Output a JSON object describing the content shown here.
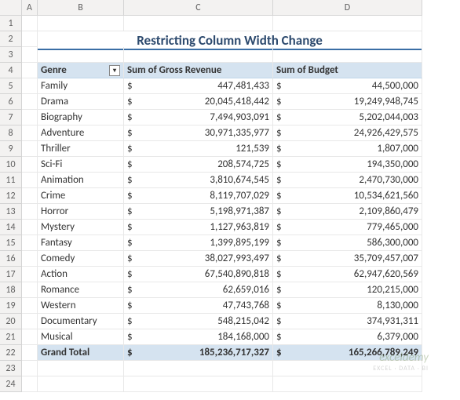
{
  "title": "Restricting Column Width Change",
  "columns": [
    "",
    "A",
    "B",
    "C",
    "D"
  ],
  "headers": {
    "genre": "Genre",
    "gross": "Sum of Gross Revenue",
    "budget": "Sum of Budget"
  },
  "chart_data": {
    "type": "table",
    "columns": [
      "Genre",
      "Sum of Gross Revenue",
      "Sum of Budget"
    ],
    "rows": [
      {
        "genre": "Family",
        "gross": "447,481,433",
        "budget": "44,500,000"
      },
      {
        "genre": "Drama",
        "gross": "20,045,418,442",
        "budget": "19,249,948,745"
      },
      {
        "genre": "Biography",
        "gross": "7,494,903,091",
        "budget": "5,202,044,003"
      },
      {
        "genre": "Adventure",
        "gross": "30,971,335,977",
        "budget": "24,926,429,575"
      },
      {
        "genre": "Thriller",
        "gross": "121,539",
        "budget": "1,807,000"
      },
      {
        "genre": "Sci-Fi",
        "gross": "208,574,725",
        "budget": "194,350,000"
      },
      {
        "genre": "Animation",
        "gross": "3,810,674,545",
        "budget": "2,470,730,000"
      },
      {
        "genre": "Crime",
        "gross": "8,119,707,029",
        "budget": "10,534,621,560"
      },
      {
        "genre": "Horror",
        "gross": "5,198,971,387",
        "budget": "2,109,860,479"
      },
      {
        "genre": "Mystery",
        "gross": "1,127,963,819",
        "budget": "779,465,000"
      },
      {
        "genre": "Fantasy",
        "gross": "1,399,895,199",
        "budget": "586,300,000"
      },
      {
        "genre": "Comedy",
        "gross": "38,027,993,497",
        "budget": "35,709,457,007"
      },
      {
        "genre": "Action",
        "gross": "67,540,890,818",
        "budget": "62,947,620,569"
      },
      {
        "genre": "Romance",
        "gross": "62,659,016",
        "budget": "120,215,000"
      },
      {
        "genre": "Western",
        "gross": "47,743,768",
        "budget": "8,130,000"
      },
      {
        "genre": "Documentary",
        "gross": "548,215,042",
        "budget": "374,931,311"
      },
      {
        "genre": "Musical",
        "gross": "184,168,000",
        "budget": "6,379,000"
      }
    ],
    "total": {
      "label": "Grand Total",
      "gross": "185,236,717,327",
      "budget": "165,266,789,249"
    }
  },
  "watermark": {
    "main": "exceldemy",
    "sub": "EXCEL · DATA · BI"
  },
  "currency": "$"
}
